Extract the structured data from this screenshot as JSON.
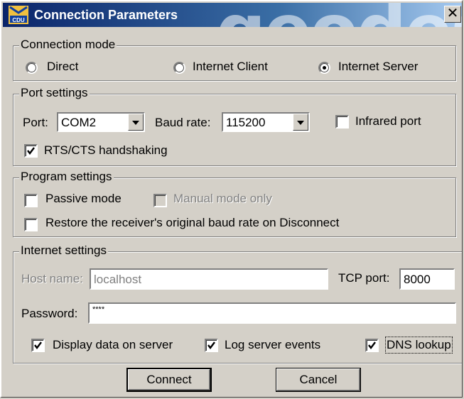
{
  "window": {
    "title": "Connection Parameters",
    "close_glyph": "✕",
    "icon_label": "CDU",
    "watermark": "geodesi"
  },
  "connection_mode": {
    "title": "Connection mode",
    "options": [
      {
        "label": "Direct",
        "selected": false
      },
      {
        "label": "Internet Client",
        "selected": false
      },
      {
        "label": "Internet Server",
        "selected": true
      }
    ]
  },
  "port_settings": {
    "title": "Port settings",
    "port_label": "Port:",
    "port_value": "COM2",
    "baud_label": "Baud rate:",
    "baud_value": "115200",
    "infrared_label": "Infrared port",
    "infrared_checked": false,
    "rts_label": "RTS/CTS handshaking",
    "rts_checked": true
  },
  "program_settings": {
    "title": "Program settings",
    "passive_label": "Passive mode",
    "passive_checked": false,
    "manual_label": "Manual mode only",
    "manual_checked": false,
    "restore_label": "Restore the receiver's original baud rate on Disconnect",
    "restore_checked": false
  },
  "internet_settings": {
    "title": "Internet settings",
    "host_label": "Host name:",
    "host_value": "localhost",
    "tcp_label": "TCP port:",
    "tcp_value": "8000",
    "password_label": "Password:",
    "password_value": "****",
    "display_label": "Display data on server",
    "display_checked": true,
    "log_label": "Log server events",
    "log_checked": true,
    "dns_label": "DNS lookup",
    "dns_checked": true
  },
  "buttons": {
    "connect": "Connect",
    "cancel": "Cancel"
  }
}
